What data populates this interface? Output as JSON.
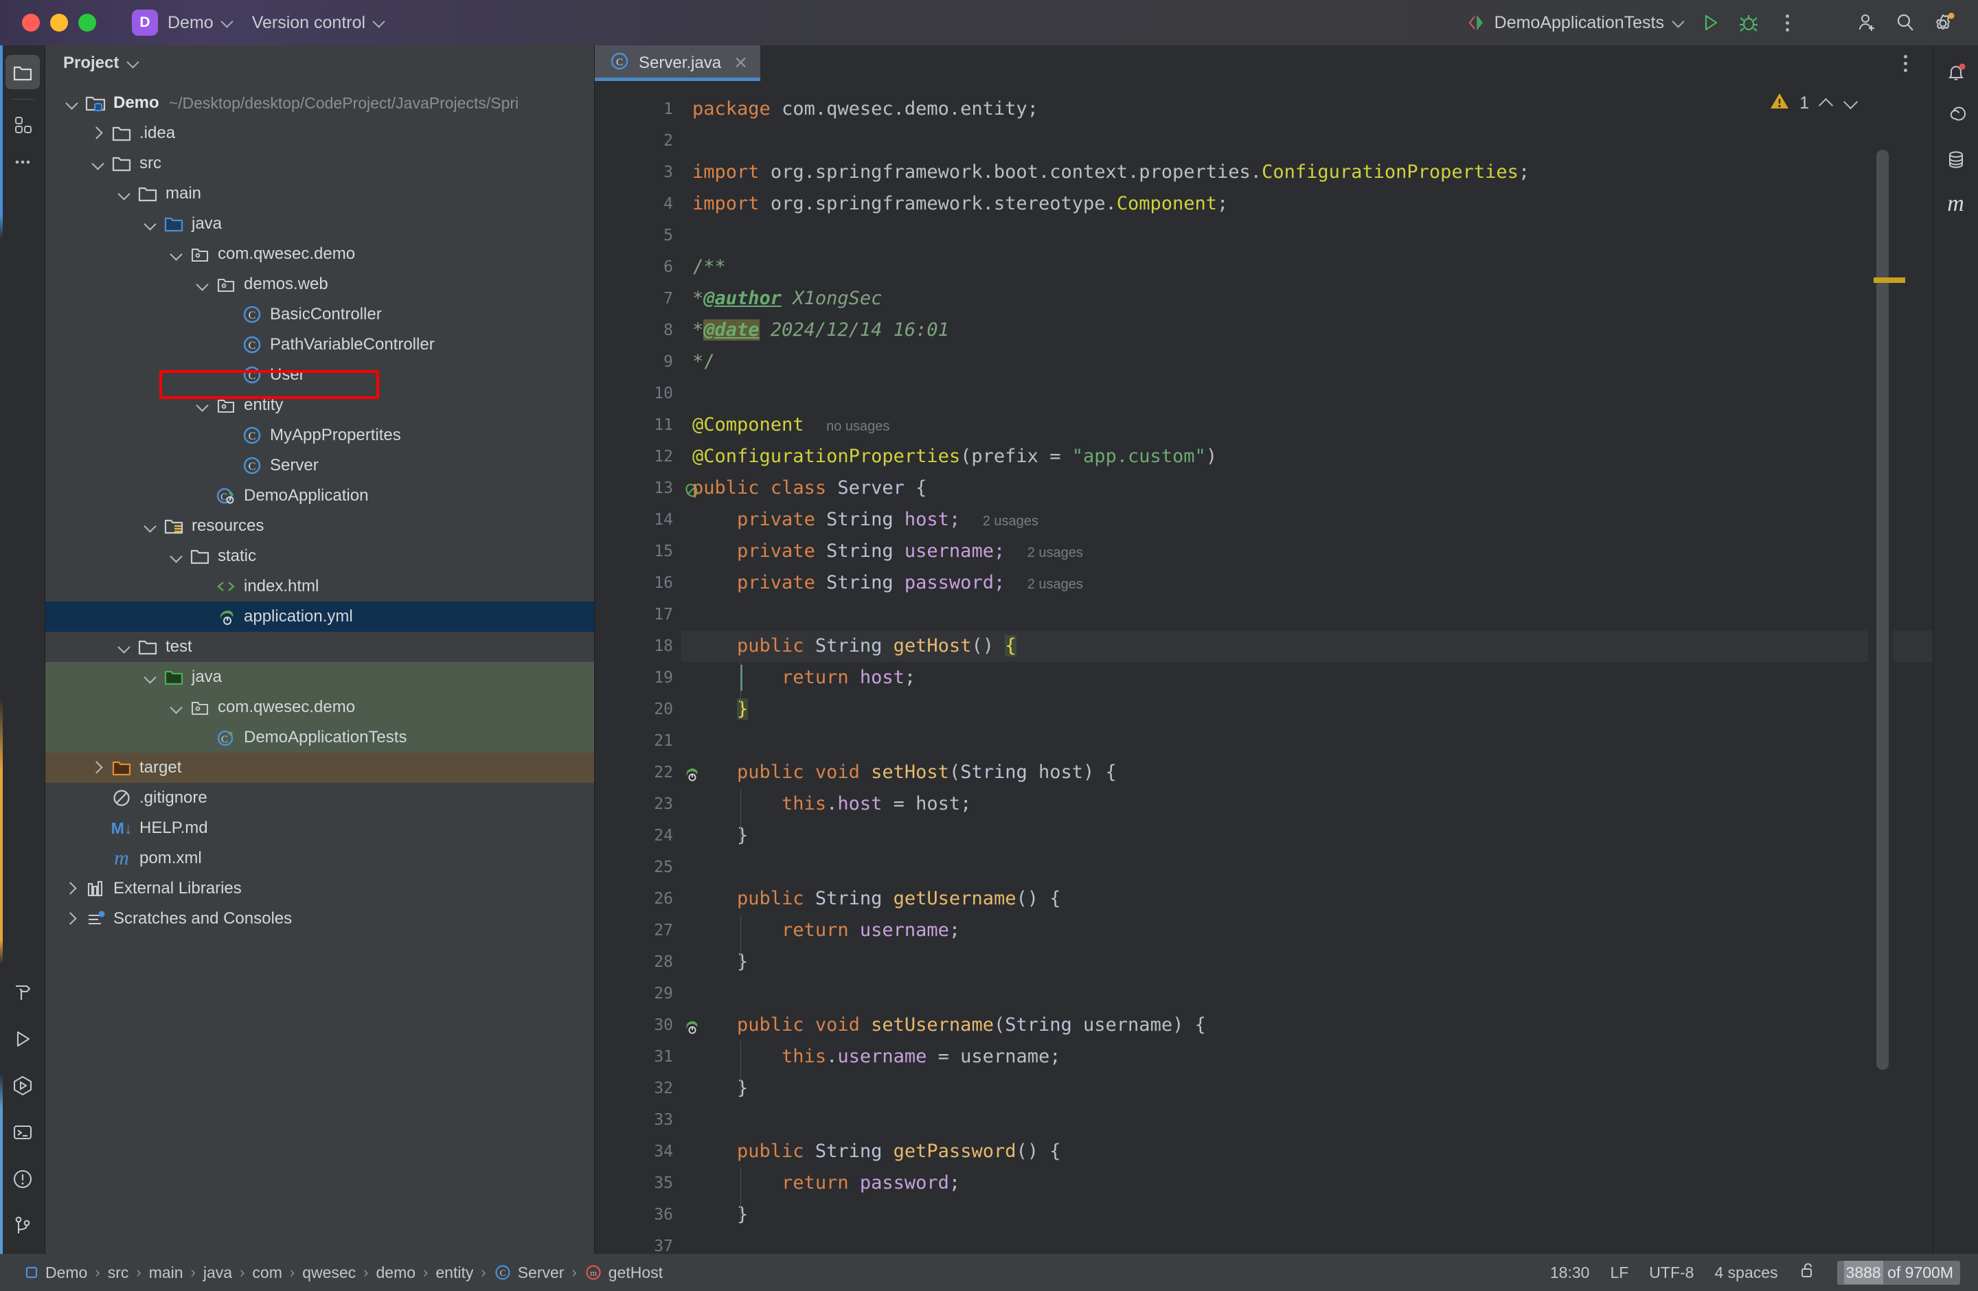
{
  "titlebar": {
    "project_badge": "D",
    "project_name": "Demo",
    "version_control": "Version control",
    "run_config": "DemoApplicationTests",
    "icons": {
      "run": "run-icon",
      "debug": "debug-icon",
      "more": "more-options-icon",
      "add_user": "add-user-icon",
      "search": "search-icon",
      "settings": "settings-icon"
    }
  },
  "rail": {
    "top": [
      "project-icon",
      "structure-icon",
      "more-tool-windows-icon"
    ],
    "bottom": [
      "build-icon",
      "run-tool-icon",
      "services-icon",
      "terminal-icon",
      "problems-icon",
      "version-control-icon"
    ]
  },
  "project_panel": {
    "header": "Project",
    "tree": [
      {
        "label": "Demo",
        "path": "~/Desktop/desktop/CodeProject/JavaProjects/Spri",
        "depth": 0,
        "arrow": "down",
        "icon": "module-folder-icon",
        "bold": true,
        "state": "none"
      },
      {
        "label": ".idea",
        "path": "",
        "depth": 1,
        "arrow": "right",
        "icon": "folder-icon",
        "bold": false,
        "state": "none"
      },
      {
        "label": "src",
        "path": "",
        "depth": 1,
        "arrow": "down",
        "icon": "folder-icon",
        "bold": false,
        "state": "none"
      },
      {
        "label": "main",
        "path": "",
        "depth": 2,
        "arrow": "down",
        "icon": "folder-icon",
        "bold": false,
        "state": "none"
      },
      {
        "label": "java",
        "path": "",
        "depth": 3,
        "arrow": "down",
        "icon": "source-root-icon",
        "bold": false,
        "state": "none"
      },
      {
        "label": "com.qwesec.demo",
        "path": "",
        "depth": 4,
        "arrow": "down",
        "icon": "package-icon",
        "bold": false,
        "state": "none"
      },
      {
        "label": "demos.web",
        "path": "",
        "depth": 5,
        "arrow": "down",
        "icon": "package-icon",
        "bold": false,
        "state": "none"
      },
      {
        "label": "BasicController",
        "path": "",
        "depth": 6,
        "arrow": "none",
        "icon": "java-class-icon",
        "bold": false,
        "state": "none"
      },
      {
        "label": "PathVariableController",
        "path": "",
        "depth": 6,
        "arrow": "none",
        "icon": "java-class-icon",
        "bold": false,
        "state": "none"
      },
      {
        "label": "User",
        "path": "",
        "depth": 6,
        "arrow": "none",
        "icon": "java-class-icon",
        "bold": false,
        "state": "none"
      },
      {
        "label": "entity",
        "path": "",
        "depth": 5,
        "arrow": "down",
        "icon": "package-icon",
        "bold": false,
        "state": "none"
      },
      {
        "label": "MyAppPropertites",
        "path": "",
        "depth": 6,
        "arrow": "none",
        "icon": "java-class-icon",
        "bold": false,
        "state": "none"
      },
      {
        "label": "Server",
        "path": "",
        "depth": 6,
        "arrow": "none",
        "icon": "java-class-icon",
        "bold": false,
        "state": "highlighted"
      },
      {
        "label": "DemoApplication",
        "path": "",
        "depth": 5,
        "arrow": "none",
        "icon": "spring-class-icon",
        "bold": false,
        "state": "none"
      },
      {
        "label": "resources",
        "path": "",
        "depth": 3,
        "arrow": "down",
        "icon": "resource-root-icon",
        "bold": false,
        "state": "none"
      },
      {
        "label": "static",
        "path": "",
        "depth": 4,
        "arrow": "down",
        "icon": "folder-icon",
        "bold": false,
        "state": "none"
      },
      {
        "label": "index.html",
        "path": "",
        "depth": 5,
        "arrow": "none",
        "icon": "html-file-icon",
        "bold": false,
        "state": "none"
      },
      {
        "label": "application.yml",
        "path": "",
        "depth": 5,
        "arrow": "none",
        "icon": "spring-yaml-icon",
        "bold": false,
        "state": "selected"
      },
      {
        "label": "test",
        "path": "",
        "depth": 2,
        "arrow": "down",
        "icon": "folder-icon",
        "bold": false,
        "state": "none"
      },
      {
        "label": "java",
        "path": "",
        "depth": 3,
        "arrow": "down",
        "icon": "test-source-root-icon",
        "bold": false,
        "state": "test"
      },
      {
        "label": "com.qwesec.demo",
        "path": "",
        "depth": 4,
        "arrow": "down",
        "icon": "package-icon",
        "bold": false,
        "state": "test"
      },
      {
        "label": "DemoApplicationTests",
        "path": "",
        "depth": 5,
        "arrow": "none",
        "icon": "test-class-icon",
        "bold": false,
        "state": "test"
      },
      {
        "label": "target",
        "path": "",
        "depth": 1,
        "arrow": "right",
        "icon": "excluded-folder-icon",
        "bold": false,
        "state": "excluded"
      },
      {
        "label": ".gitignore",
        "path": "",
        "depth": 1,
        "arrow": "none",
        "icon": "gitignore-icon",
        "bold": false,
        "state": "none"
      },
      {
        "label": "HELP.md",
        "path": "",
        "depth": 1,
        "arrow": "none",
        "icon": "markdown-icon",
        "bold": false,
        "state": "none"
      },
      {
        "label": "pom.xml",
        "path": "",
        "depth": 1,
        "arrow": "none",
        "icon": "maven-icon",
        "bold": false,
        "state": "none"
      },
      {
        "label": "External Libraries",
        "path": "",
        "depth": 0,
        "arrow": "right",
        "icon": "libraries-icon",
        "bold": false,
        "state": "none"
      },
      {
        "label": "Scratches and Consoles",
        "path": "",
        "depth": 0,
        "arrow": "right",
        "icon": "scratches-icon",
        "bold": false,
        "state": "none"
      }
    ]
  },
  "editor": {
    "tab": {
      "label": "Server.java",
      "icon": "java-class-icon",
      "close": "✕"
    },
    "warning_count": "1",
    "warning_icon": "warning-triangle-icon",
    "lines": [
      {
        "n": "1",
        "html": "<span class=\"kw\">package</span> <span class=\"pln\">com.qwesec.demo.entity;</span>",
        "mark": ""
      },
      {
        "n": "2",
        "html": "",
        "mark": ""
      },
      {
        "n": "3",
        "html": "<span class=\"kw\">import</span> <span class=\"pln\">org.springframework.boot.context.properties.</span><span class=\"ann\">ConfigurationProperties</span><span class=\"pln\">;</span>",
        "mark": ""
      },
      {
        "n": "4",
        "html": "<span class=\"kw\">import</span> <span class=\"pln\">org.springframework.stereotype.</span><span class=\"ann\">Component</span><span class=\"pln\">;</span>",
        "mark": ""
      },
      {
        "n": "5",
        "html": "",
        "mark": ""
      },
      {
        "n": "6",
        "html": "<span class=\"cmt\">/**</span>",
        "mark": ""
      },
      {
        "n": "7",
        "html": "<span class=\"cmt\">*</span><span class=\"doc-tag\">@author</span> <span class=\"doc-it\">X1ongSec</span>",
        "mark": ""
      },
      {
        "n": "8",
        "html": "<span class=\"cmt\">*</span><span class=\"doc-tag mark\">@date</span> <span class=\"doc-it\">2024/12/14 16:01</span>",
        "mark": ""
      },
      {
        "n": "9",
        "html": "<span class=\"cmt\">*/</span>",
        "mark": ""
      },
      {
        "n": "10",
        "html": "",
        "mark": ""
      },
      {
        "n": "11",
        "html": "<span class=\"ann\">@Component</span>  <span class=\"usages\">no usages</span>",
        "mark": ""
      },
      {
        "n": "12",
        "html": "<span class=\"ann\">@ConfigurationProperties</span><span class=\"pln\">(</span><span class=\"pln\">prefix</span> <span class=\"pln\">=</span> <span class=\"str\">\"app.custom\"</span><span class=\"pln\">)</span>",
        "mark": ""
      },
      {
        "n": "13",
        "html": "<span class=\"kw\">public</span> <span class=\"kw\">class</span> <span class=\"typ\">Server</span> <span class=\"pln\">{</span>",
        "mark": "bean"
      },
      {
        "n": "14",
        "html": "    <span class=\"kw\">private</span> <span class=\"typ\">String</span> <span class=\"fld\">host</span><span class=\"fld\">;</span>  <span class=\"usages\">2 usages</span>",
        "mark": ""
      },
      {
        "n": "15",
        "html": "    <span class=\"kw\">private</span> <span class=\"typ\">String</span> <span class=\"fld\">username</span><span class=\"fld\">;</span>  <span class=\"usages\">2 usages</span>",
        "mark": ""
      },
      {
        "n": "16",
        "html": "    <span class=\"kw\">private</span> <span class=\"typ\">String</span> <span class=\"fld\">password</span><span class=\"fld\">;</span>  <span class=\"usages\">2 usages</span>",
        "mark": ""
      },
      {
        "n": "17",
        "html": "",
        "mark": ""
      },
      {
        "n": "18",
        "html": "    <span class=\"kw\">public</span> <span class=\"typ\">String</span> <span class=\"mth\">getHost</span><span class=\"pln\">() </span><span class=\"brace-hl\">{</span>",
        "mark": "",
        "hl": true
      },
      {
        "n": "19",
        "html": "        <span class=\"kw\">return</span> <span class=\"fld\">host</span><span class=\"pln\">;</span>",
        "mark": ""
      },
      {
        "n": "20",
        "html": "    <span class=\"brace-hl\">}</span>",
        "mark": ""
      },
      {
        "n": "21",
        "html": "",
        "mark": ""
      },
      {
        "n": "22",
        "html": "    <span class=\"kw\">public</span> <span class=\"kw\">void</span> <span class=\"mth\">setHost</span><span class=\"pln\">(</span><span class=\"typ\">String</span> <span class=\"pln\">host) {</span>",
        "mark": "spring"
      },
      {
        "n": "23",
        "html": "        <span class=\"kw\">this</span><span class=\"pln\">.</span><span class=\"fld\">host</span> <span class=\"pln\">= host;</span>",
        "mark": ""
      },
      {
        "n": "24",
        "html": "    <span class=\"pln\">}</span>",
        "mark": ""
      },
      {
        "n": "25",
        "html": "",
        "mark": ""
      },
      {
        "n": "26",
        "html": "    <span class=\"kw\">public</span> <span class=\"typ\">String</span> <span class=\"mth\">getUsername</span><span class=\"pln\">() {</span>",
        "mark": ""
      },
      {
        "n": "27",
        "html": "        <span class=\"kw\">return</span> <span class=\"fld\">username</span><span class=\"pln\">;</span>",
        "mark": ""
      },
      {
        "n": "28",
        "html": "    <span class=\"pln\">}</span>",
        "mark": ""
      },
      {
        "n": "29",
        "html": "",
        "mark": ""
      },
      {
        "n": "30",
        "html": "    <span class=\"kw\">public</span> <span class=\"kw\">void</span> <span class=\"mth\">setUsername</span><span class=\"pln\">(</span><span class=\"typ\">String</span> <span class=\"pln\">username) {</span>",
        "mark": "spring"
      },
      {
        "n": "31",
        "html": "        <span class=\"kw\">this</span><span class=\"pln\">.</span><span class=\"fld\">username</span> <span class=\"pln\">= username;</span>",
        "mark": ""
      },
      {
        "n": "32",
        "html": "    <span class=\"pln\">}</span>",
        "mark": ""
      },
      {
        "n": "33",
        "html": "",
        "mark": ""
      },
      {
        "n": "34",
        "html": "    <span class=\"kw\">public</span> <span class=\"typ\">String</span> <span class=\"mth\">getPassword</span><span class=\"pln\">() {</span>",
        "mark": ""
      },
      {
        "n": "35",
        "html": "        <span class=\"kw\">return</span> <span class=\"fld\">password</span><span class=\"pln\">;</span>",
        "mark": ""
      },
      {
        "n": "36",
        "html": "    <span class=\"pln\">}</span>",
        "mark": ""
      },
      {
        "n": "37",
        "html": "",
        "mark": ""
      }
    ]
  },
  "right_rail": [
    "notifications-icon",
    "ai-assistant-icon",
    "database-icon",
    "maven-icon"
  ],
  "status_bar": {
    "breadcrumbs": [
      "Demo",
      "src",
      "main",
      "java",
      "com",
      "qwesec",
      "demo",
      "entity",
      "Server",
      "getHost"
    ],
    "time": "18:30",
    "line_separator": "LF",
    "encoding": "UTF-8",
    "indent": "4 spaces",
    "lock_icon": "unlocked-icon",
    "memory_used": "3888",
    "memory_total": " of 9700M"
  },
  "colors": {
    "accent_blue": "#4a88c7",
    "warning_yellow": "#c8a01e",
    "highlight_red": "#ff0000",
    "selection_blue": "#103050",
    "test_green": "#4d5a4c",
    "excluded_brown": "#5a4e3a"
  }
}
